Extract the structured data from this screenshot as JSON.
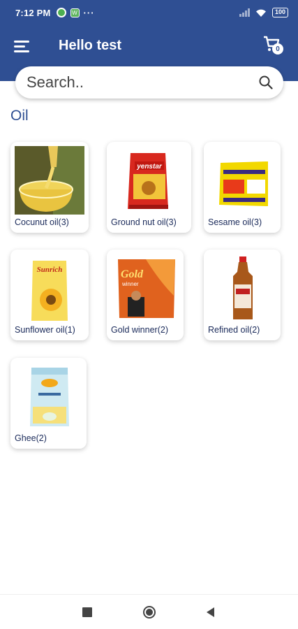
{
  "status_bar": {
    "time": "7:12 PM",
    "app_badge": "W",
    "more": "···",
    "battery": "100"
  },
  "app_bar": {
    "title": "Hello test",
    "cart_count": "0"
  },
  "search": {
    "placeholder": "Search.."
  },
  "section": {
    "title": "Oil"
  },
  "products": [
    {
      "label": "Cocunut oil(3)",
      "icon": "coconut-oil-image"
    },
    {
      "label": "Ground nut oil(3)",
      "icon": "groundnut-oil-pack-image"
    },
    {
      "label": "Sesame oil(3)",
      "icon": "sesame-oil-pack-image"
    },
    {
      "label": "Sunflower oil(1)",
      "icon": "sunflower-oil-pack-image"
    },
    {
      "label": "Gold winner(2)",
      "icon": "gold-winner-pack-image"
    },
    {
      "label": "Refined oil(2)",
      "icon": "refined-oil-bottle-image"
    },
    {
      "label": "Ghee(2)",
      "icon": "ghee-pack-image"
    }
  ],
  "colors": {
    "primary": "#2f4f93",
    "text_dark": "#1a2a5a"
  }
}
